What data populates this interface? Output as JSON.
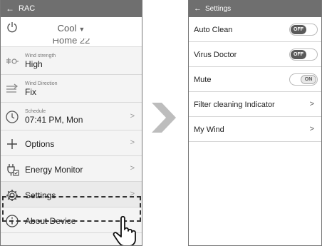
{
  "left": {
    "header_title": "RAC",
    "mode": "Cool",
    "room_name": "Home 22",
    "items": [
      {
        "small": "Wind strength",
        "value": "High"
      },
      {
        "small": "Wind Direction",
        "value": "Fix"
      },
      {
        "small": "Schedule",
        "value": "07:41 PM, Mon"
      }
    ],
    "menu": {
      "options": "Options",
      "energy": "Energy Monitor",
      "settings": "Settings",
      "about": "About Device"
    }
  },
  "right": {
    "header_title": "Settings",
    "rows": [
      {
        "label": "Auto Clean",
        "state": "OFF"
      },
      {
        "label": "Virus Doctor",
        "state": "OFF"
      },
      {
        "label": "Mute",
        "state": "ON"
      },
      {
        "label": "Filter cleaning Indicator"
      },
      {
        "label": "My Wind"
      }
    ]
  },
  "colors": {
    "header": "#6f6f6f",
    "arrow": "#bdbdbd"
  }
}
